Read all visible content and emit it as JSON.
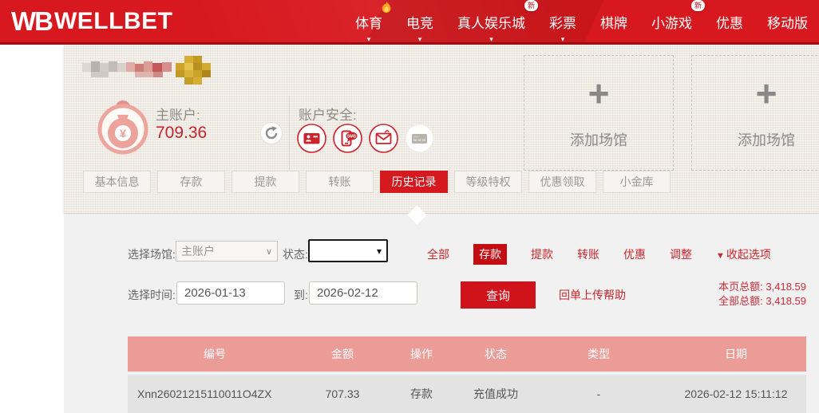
{
  "colors": {
    "nav_red": "#d7191f",
    "accent_red": "#d0121b",
    "link_red": "#c8252c",
    "active_filter_red": "#c30d13",
    "table_header_bg": "#eb9c96",
    "panel_bg": "#efebe4",
    "balance_red": "#c5242b"
  },
  "brand": {
    "logo_mark": "WB",
    "logo_text": "WELLBET"
  },
  "navbar": {
    "items": [
      {
        "label": "体育",
        "flame": true,
        "caret": true
      },
      {
        "label": "电竞",
        "caret": true
      },
      {
        "label": "真人娱乐城",
        "badge": "新",
        "caret": true
      },
      {
        "label": "彩票",
        "caret": true
      },
      {
        "label": "棋牌"
      },
      {
        "label": "小游戏",
        "badge": "新"
      },
      {
        "label": "优惠"
      },
      {
        "label": "移动版"
      }
    ]
  },
  "icons": {
    "caret_down": "▾",
    "select_chevron": "∨",
    "collapse_arrow": "▼",
    "plus": "+"
  },
  "account": {
    "balance_label": "主账户:",
    "balance_value": "709.36",
    "currency_symbol": "¥",
    "security_label": "账户安全:",
    "security_sms_text": "SMS",
    "security_icons": [
      "id-card",
      "sms-phone",
      "mail",
      "bank-card"
    ]
  },
  "add_venue": {
    "label": "添加场馆"
  },
  "tabs": [
    {
      "label": "基本信息"
    },
    {
      "label": "存款"
    },
    {
      "label": "提款"
    },
    {
      "label": "转账"
    },
    {
      "label": "历史记录",
      "active": true
    },
    {
      "label": "等级特权"
    },
    {
      "label": "优惠领取"
    },
    {
      "label": "小金库"
    }
  ],
  "filters": {
    "venue_label": "选择场馆:",
    "venue_value": "主账户",
    "status_label": "状态:",
    "status_value": "",
    "type_options": [
      {
        "label": "全部"
      },
      {
        "label": "存款",
        "active": true
      },
      {
        "label": "提款"
      },
      {
        "label": "转账"
      },
      {
        "label": "优惠"
      },
      {
        "label": "调整"
      }
    ],
    "collapse_label": "收起选项"
  },
  "date_filter": {
    "label": "选择时间:",
    "from": "2026-01-13",
    "to_label": "到:",
    "to": "2026-02-12",
    "search_label": "查询",
    "receipt_help_label": "回单上传帮助",
    "page_total_label": "本页总额:",
    "page_total": "3,418.59",
    "all_total_label": "全部总额:",
    "all_total": "3,418.59"
  },
  "table": {
    "headers": [
      "编号",
      "金额",
      "操作",
      "状态",
      "类型",
      "日期"
    ],
    "rows": [
      [
        "Xnn26021215110011O4ZX",
        "707.33",
        "存款",
        "充值成功",
        "-",
        "2026-02-12 15:11:12"
      ]
    ]
  }
}
